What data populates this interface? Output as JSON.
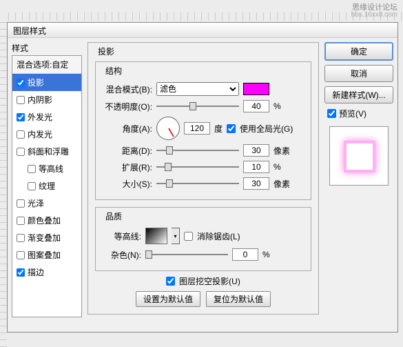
{
  "watermark": {
    "line1": "思缘设计论坛",
    "line2": "bbs.16xx8.com"
  },
  "dialog_title": "图层样式",
  "left": {
    "header": "样式",
    "blend_options": "混合选项:自定",
    "items": [
      {
        "label": "投影",
        "checked": true,
        "selected": true
      },
      {
        "label": "内阴影",
        "checked": false
      },
      {
        "label": "外发光",
        "checked": true
      },
      {
        "label": "内发光",
        "checked": false
      },
      {
        "label": "斜面和浮雕",
        "checked": false
      },
      {
        "label": "等高线",
        "checked": false,
        "indent": true
      },
      {
        "label": "纹理",
        "checked": false,
        "indent": true
      },
      {
        "label": "光泽",
        "checked": false
      },
      {
        "label": "颜色叠加",
        "checked": false
      },
      {
        "label": "渐变叠加",
        "checked": false
      },
      {
        "label": "图案叠加",
        "checked": false
      },
      {
        "label": "描边",
        "checked": true
      }
    ]
  },
  "center": {
    "title": "投影",
    "structure_title": "结构",
    "blend_mode_label": "混合模式(B):",
    "blend_mode_value": "滤色",
    "color": "#ff00ff",
    "opacity_label": "不透明度(O):",
    "opacity_value": "40",
    "pct": "%",
    "angle_label": "角度(A):",
    "angle_value": "120",
    "degree": "度",
    "global_light": "使用全局光(G)",
    "distance_label": "距离(D):",
    "distance_value": "30",
    "px": "像素",
    "spread_label": "扩展(R):",
    "spread_value": "10",
    "size_label": "大小(S):",
    "size_value": "30",
    "quality_title": "品质",
    "contour_label": "等高线:",
    "antialias": "消除锯齿(L)",
    "noise_label": "杂色(N):",
    "noise_value": "0",
    "knockout": "图层挖空投影(U)",
    "set_default": "设置为默认值",
    "reset_default": "复位为默认值"
  },
  "right": {
    "ok": "确定",
    "cancel": "取消",
    "new_style": "新建样式(W)...",
    "preview": "预览(V)"
  }
}
